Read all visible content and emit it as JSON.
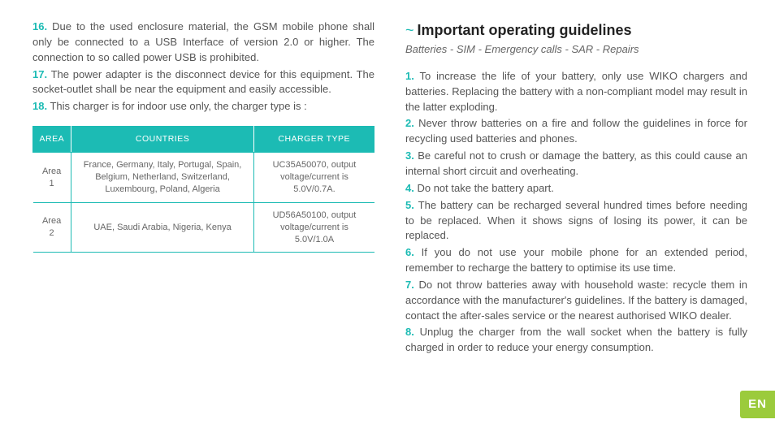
{
  "left": {
    "items": [
      {
        "num": "16.",
        "text": "Due to the used enclosure material, the GSM mobile phone shall only be connected to a USB Interface of version 2.0 or higher. The connection to so called power USB is prohibited."
      },
      {
        "num": "17.",
        "text": "The power adapter is the disconnect device for this equipment. The socket-outlet shall be near the equipment and easily accessible."
      },
      {
        "num": "18.",
        "text": "This charger is for indoor use only, the charger type is :"
      }
    ],
    "table": {
      "headers": [
        "AREA",
        "COUNTRIES",
        "CHARGER TYPE"
      ],
      "rows": [
        {
          "area": "Area 1",
          "countries": "France, Germany, Italy, Portugal, Spain, Belgium, Netherland, Switzerland, Luxembourg, Poland, Algeria",
          "charger": "UC35A50070, output voltage/current is 5.0V/0.7A."
        },
        {
          "area": "Area 2",
          "countries": "UAE, Saudi Arabia, Nigeria, Kenya",
          "charger": "UD56A50100, output voltage/current is 5.0V/1.0A"
        }
      ]
    }
  },
  "right": {
    "tilde": "~",
    "title": "Important operating guidelines",
    "subtitle": "Batteries - SIM - Emergency calls - SAR - Repairs",
    "items": [
      {
        "num": "1.",
        "text": "To increase the life of your battery, only use WIKO chargers and batteries. Replacing the battery with a non-compliant model may result in the latter exploding."
      },
      {
        "num": "2.",
        "text": "Never throw batteries on a fire and follow the guidelines in force for recycling used batteries and phones."
      },
      {
        "num": "3.",
        "text": "Be careful not to crush or damage the battery, as this could cause an internal short circuit and overheating."
      },
      {
        "num": "4.",
        "text": "Do not take the battery apart."
      },
      {
        "num": "5.",
        "text": "The battery can be recharged several hundred times before needing to be replaced. When it shows signs of losing its power, it can be replaced."
      },
      {
        "num": "6.",
        "text": "If you do not use your mobile phone for an extended period, remember to recharge the battery to optimise its use time."
      },
      {
        "num": "7.",
        "text": "Do not throw batteries away with household waste: recycle them in accordance with the manufacturer's guidelines. If the battery is damaged, contact the after-sales service or the nearest authorised WIKO dealer."
      },
      {
        "num": "8.",
        "text": "Unplug the charger from the wall socket when the battery is fully charged in order to reduce your energy consumption."
      }
    ]
  },
  "lang": "EN"
}
